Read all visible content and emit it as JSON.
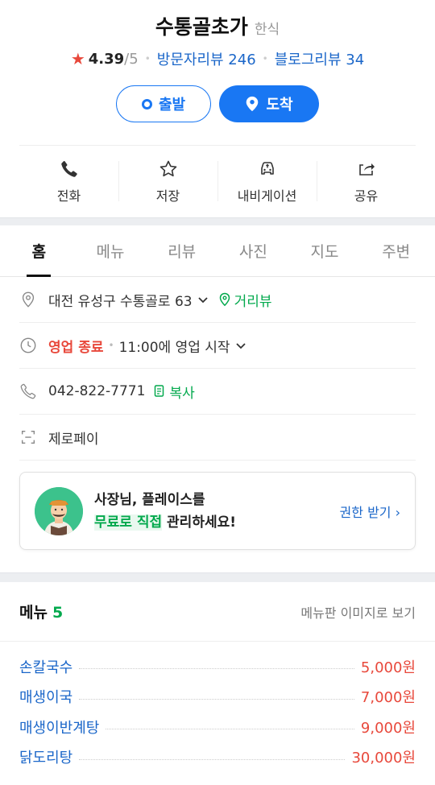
{
  "place": {
    "name": "수통골초가",
    "category": "한식",
    "rating": "4.39",
    "rating_max": "/5",
    "visitor_reviews": "방문자리뷰 246",
    "blog_reviews": "블로그리뷰 34"
  },
  "actions": {
    "depart": "출발",
    "arrive": "도착"
  },
  "quick": {
    "call": "전화",
    "save": "저장",
    "navigation": "내비게이션",
    "share": "공유"
  },
  "tabs": [
    "홈",
    "메뉴",
    "리뷰",
    "사진",
    "지도",
    "주변"
  ],
  "info": {
    "address": "대전 유성구 수통골로 63",
    "street_view": "거리뷰",
    "status": "영업 종료",
    "hours": "11:00에 영업 시작",
    "phone": "042-822-7771",
    "copy": "복사",
    "pay": "제로페이"
  },
  "owner_card": {
    "line1": "사장님, 플레이스를",
    "highlight": "무료로 직접",
    "line2_rest": " 관리하세요!",
    "link": "권한 받기 ›"
  },
  "menu": {
    "title": "메뉴",
    "count": "5",
    "image_link": "메뉴판 이미지로 보기",
    "items": [
      {
        "name": "손칼국수",
        "price": "5,000원"
      },
      {
        "name": "매생이국",
        "price": "7,000원"
      },
      {
        "name": "매생이반계탕",
        "price": "9,000원"
      },
      {
        "name": "닭도리탕",
        "price": "30,000원"
      }
    ]
  },
  "colors": {
    "primary_blue": "#1977f3",
    "link_blue": "#1a66c9",
    "green": "#03a94d",
    "red": "#e8483b"
  }
}
